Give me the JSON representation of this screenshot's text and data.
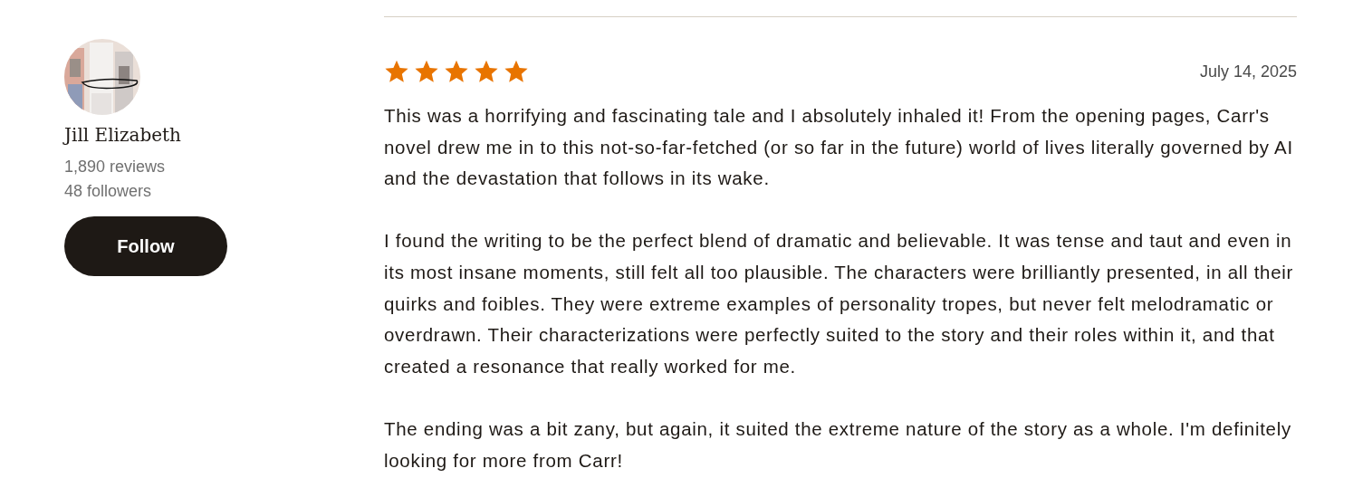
{
  "reviewer": {
    "name": "Jill Elizabeth",
    "reviews": "1,890 reviews",
    "followers": "48 followers",
    "follow_button": "Follow"
  },
  "review": {
    "stars": 5,
    "date": "July 14, 2025",
    "paragraphs": [
      "This was a horrifying and fascinating tale and I absolutely inhaled it! From the opening pages, Carr's novel drew me in to this not-so-far-fetched (or so far in the future) world of lives literally governed by AI and the devastation that follows in its wake.",
      "I found the writing to be the perfect blend of dramatic and believable. It was tense and taut and even in its most insane moments, still felt all too plausible. The characters were brilliantly presented, in all their quirks and foibles. They were extreme examples of personality tropes, but never felt melodramatic or overdrawn. Their characterizations were perfectly suited to the story and their roles within it, and that created a resonance that really worked for me.",
      "The ending was a bit zany, but again, it suited the extreme nature of the story as a whole. I'm definitely looking for more from Carr!"
    ]
  }
}
